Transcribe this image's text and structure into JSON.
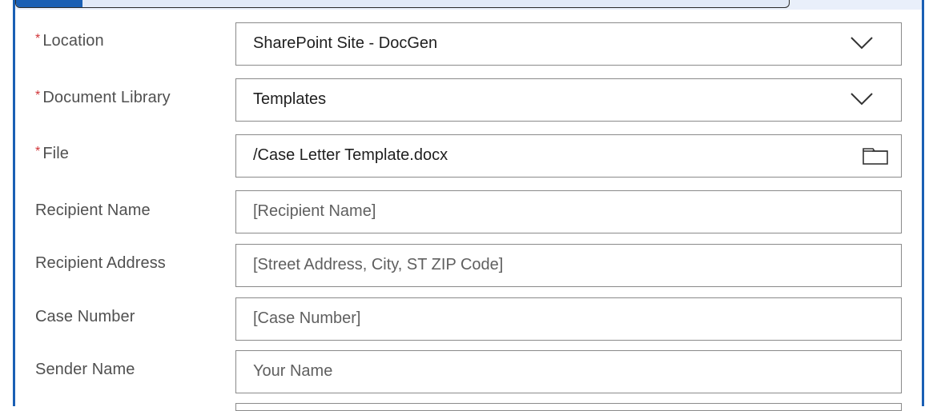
{
  "form": {
    "location": {
      "label": "Location",
      "required_mark": "*",
      "value": "SharePoint Site - DocGen",
      "icon": "chevron-down-icon"
    },
    "document_library": {
      "label": "Document Library",
      "required_mark": "*",
      "value": "Templates",
      "icon": "chevron-down-icon"
    },
    "file": {
      "label": "File",
      "required_mark": "*",
      "value": "/Case Letter Template.docx",
      "icon": "folder-icon"
    },
    "recipient_name": {
      "label": "Recipient Name",
      "placeholder": "[Recipient Name]"
    },
    "recipient_address": {
      "label": "Recipient Address",
      "placeholder": "[Street Address, City, ST ZIP Code]"
    },
    "case_number": {
      "label": "Case Number",
      "placeholder": "[Case Number]"
    },
    "sender_name": {
      "label": "Sender Name",
      "placeholder": "Your Name"
    }
  },
  "colors": {
    "accent": "#1a5fb4",
    "required": "#d13438",
    "border": "#8a8a8a",
    "label": "#505050",
    "placeholder": "#5f5f5f"
  }
}
